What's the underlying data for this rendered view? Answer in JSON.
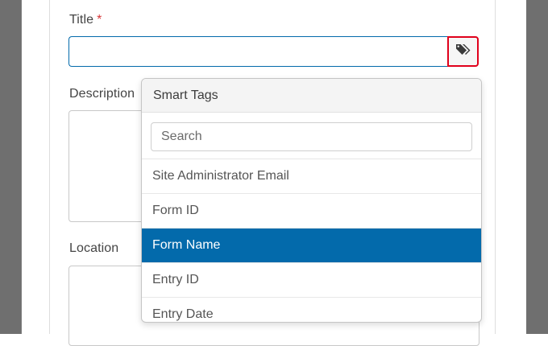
{
  "form": {
    "title_label": "Title",
    "title_required_marker": "*",
    "title_value": "",
    "description_label": "Description",
    "location_label": "Location"
  },
  "smart_tags": {
    "button_icon": "tag-icon",
    "header": "Smart Tags",
    "search_placeholder": "Search",
    "items": [
      {
        "label": "Site Administrator Email",
        "selected": false
      },
      {
        "label": "Form ID",
        "selected": false
      },
      {
        "label": "Form Name",
        "selected": true
      },
      {
        "label": "Entry ID",
        "selected": false
      },
      {
        "label": "Entry Date",
        "selected": false
      }
    ]
  },
  "colors": {
    "accent": "#036aab",
    "highlight_border": "#e0001b",
    "required": "#d63638",
    "backdrop": "#6f6f6f"
  }
}
